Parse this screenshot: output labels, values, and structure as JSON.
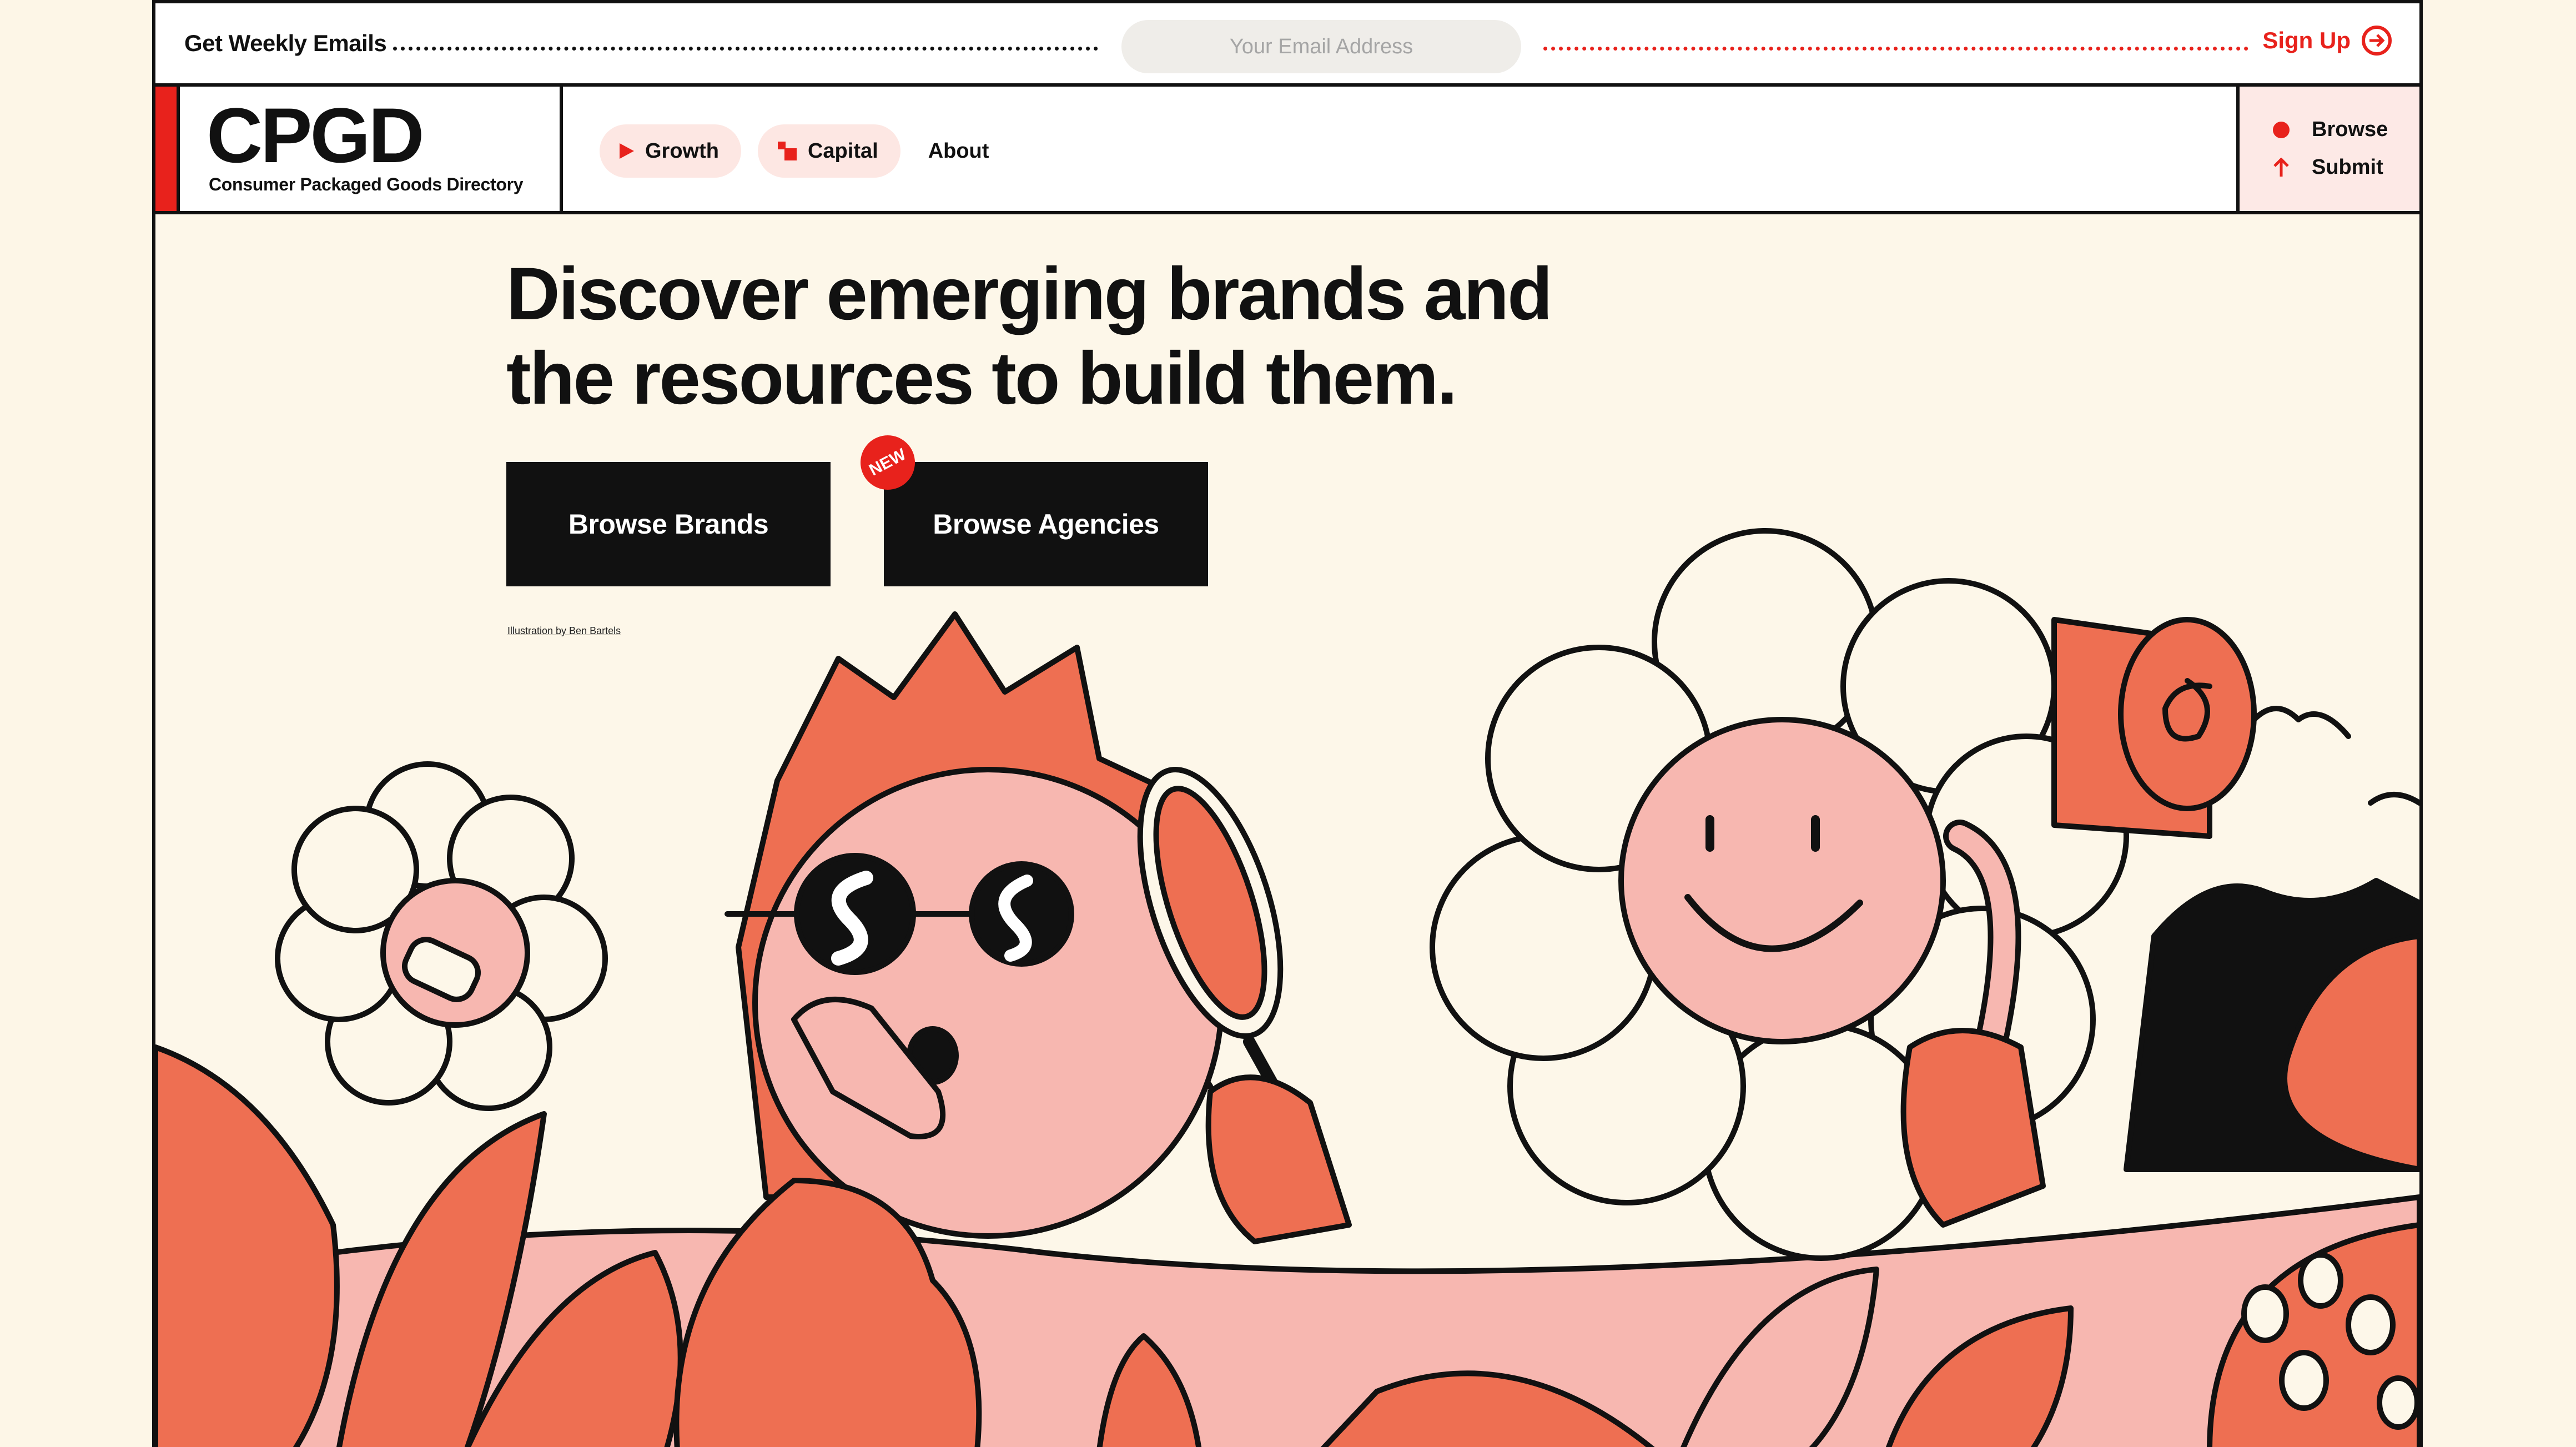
{
  "email_bar": {
    "label": "Get Weekly Emails",
    "placeholder": "Your Email Address",
    "signup_label": "Sign Up"
  },
  "header": {
    "logo": "CPGD",
    "tagline": "Consumer Packaged Goods Directory",
    "nav": [
      {
        "label": "Growth",
        "icon": "play-triangle-icon"
      },
      {
        "label": "Capital",
        "icon": "squares-icon"
      },
      {
        "label": "About"
      }
    ],
    "side": {
      "browse": "Browse",
      "submit": "Submit"
    }
  },
  "hero": {
    "title_line1": "Discover emerging brands and",
    "title_line2": "the resources to build them.",
    "btn_brands": "Browse Brands",
    "btn_agencies": "Browse Agencies",
    "new_badge": "NEW",
    "credit": "Illustration by Ben Bartels"
  },
  "colors": {
    "accent": "#e8221c",
    "coral": "#ee6f52",
    "pink": "#f7b7b0",
    "cream": "#fdf7e9",
    "ink": "#111111"
  }
}
